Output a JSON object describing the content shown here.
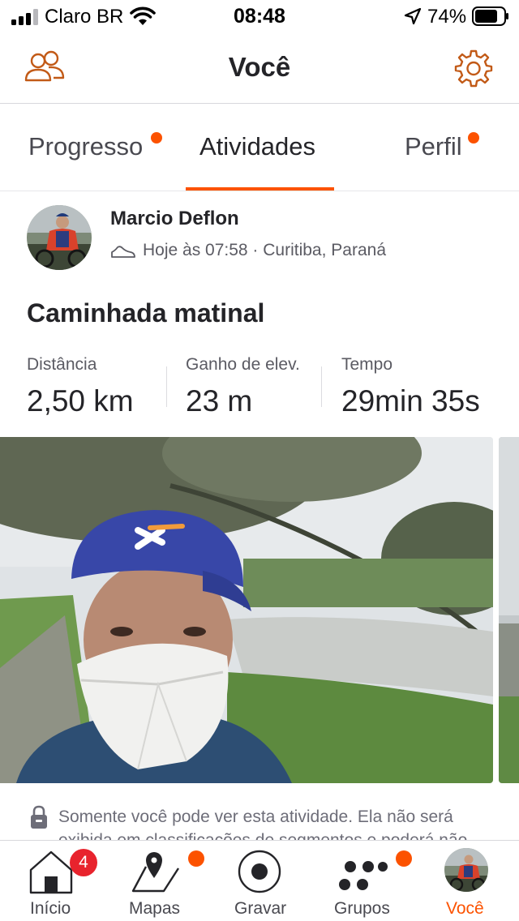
{
  "status_bar": {
    "carrier": "Claro BR",
    "time": "08:48",
    "battery_percent": "74%",
    "signal_bars_filled": 3,
    "signal_bars_total": 4
  },
  "header": {
    "title": "Você",
    "left_icon": "friends-icon",
    "right_icon": "settings-gear-icon"
  },
  "tabs": [
    {
      "label": "Progresso",
      "has_dot": true,
      "active": false
    },
    {
      "label": "Atividades",
      "has_dot": false,
      "active": true
    },
    {
      "label": "Perfil",
      "has_dot": true,
      "active": false
    }
  ],
  "activity": {
    "athlete_name": "Marcio Deflon",
    "meta": "Hoje às 07:58 · Curitiba, Paraná",
    "title": "Caminhada matinal",
    "stats": [
      {
        "label": "Distância",
        "value": "2,50 km"
      },
      {
        "label": "Ganho de elev.",
        "value": "23 m"
      },
      {
        "label": "Tempo",
        "value": "29min 35s"
      }
    ],
    "privacy_notice": "Somente você pode ver esta atividade. Ela não será exibida em classificações de segmentos e poderá não"
  },
  "tab_bar": {
    "items": [
      {
        "label": "Início",
        "icon": "home-icon",
        "badge": "4",
        "active": false
      },
      {
        "label": "Mapas",
        "icon": "maps-icon",
        "dot": true,
        "active": false
      },
      {
        "label": "Gravar",
        "icon": "record-icon",
        "active": false
      },
      {
        "label": "Grupos",
        "icon": "groups-icon",
        "dot": true,
        "active": false
      },
      {
        "label": "Você",
        "icon": "avatar",
        "active": true
      }
    ]
  },
  "colors": {
    "accent": "#fc5200",
    "badge": "#e8232d",
    "text_primary": "#242428",
    "text_secondary": "#5b5b63"
  }
}
